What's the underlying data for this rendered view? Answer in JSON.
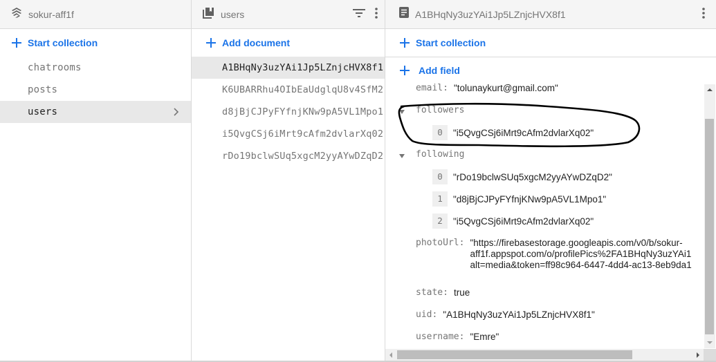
{
  "root_panel": {
    "project_name": "sokur-aff1f",
    "start_collection_label": "Start collection",
    "collections": [
      {
        "name": "chatrooms",
        "selected": false
      },
      {
        "name": "posts",
        "selected": false
      },
      {
        "name": "users",
        "selected": true
      }
    ]
  },
  "collection_panel": {
    "title": "users",
    "add_document_label": "Add document",
    "documents": [
      {
        "id": "A1BHqNy3uzYAi1Jp5LZnjcHVX8f1",
        "selected": true
      },
      {
        "id": "K6UBARRhu4OIbEaUdglqU8v4SfM2",
        "selected": false
      },
      {
        "id": "d8jBjCJPyFYfnjKNw9pA5VL1Mpo1",
        "selected": false
      },
      {
        "id": "i5QvgCSj6iMrt9cAfm2dvlarXq02",
        "selected": false
      },
      {
        "id": "rDo19bclwSUq5xgcM2yyAYwDZqD2",
        "selected": false
      }
    ]
  },
  "document_panel": {
    "title": "A1BHqNy3uzYAi1Jp5LZnjcHVX8f1",
    "start_collection_label": "Start collection",
    "add_field_label": "Add field",
    "fields": {
      "email": {
        "key": "email:",
        "value": "\"tolunaykurt@gmail.com\""
      },
      "followers": {
        "key": "followers",
        "items": [
          {
            "index": "0",
            "value": "\"i5QvgCSj6iMrt9cAfm2dvlarXq02\""
          }
        ]
      },
      "following": {
        "key": "following",
        "items": [
          {
            "index": "0",
            "value": "\"rDo19bclwSUq5xgcM2yyAYwDZqD2\""
          },
          {
            "index": "1",
            "value": "\"d8jBjCJPyFYfnjKNw9pA5VL1Mpo1\""
          },
          {
            "index": "2",
            "value": "\"i5QvgCSj6iMrt9cAfm2dvlarXq02\""
          }
        ]
      },
      "photoUrl": {
        "key": "photoUrl:",
        "lines": [
          "\"https://firebasestorage.googleapis.com/v0/b/sokur-",
          "aff1f.appspot.com/o/profilePics%2FA1BHqNy3uzYAi1",
          "alt=media&token=ff98c964-6447-4dd4-ac13-8eb9da1"
        ]
      },
      "state": {
        "key": "state:",
        "value": "true"
      },
      "uid": {
        "key": "uid:",
        "value": "\"A1BHqNy3uzYAi1Jp5LZnjcHVX8f1\""
      },
      "username": {
        "key": "username:",
        "value": "\"Emre\""
      }
    }
  },
  "icons": {
    "project": "firestore-stack-icon",
    "collection": "collection-icon",
    "document": "document-icon",
    "filter": "filter-icon",
    "more": "more-vert-icon",
    "add": "plus-icon",
    "chevron": "chevron-right-icon",
    "expand": "caret-down-icon"
  },
  "colors": {
    "accent": "#1a73e8",
    "header_bg": "#f5f5f5",
    "selected_bg": "#e8e8e8",
    "muted_text": "#757575",
    "annotation_stroke": "#000000"
  }
}
